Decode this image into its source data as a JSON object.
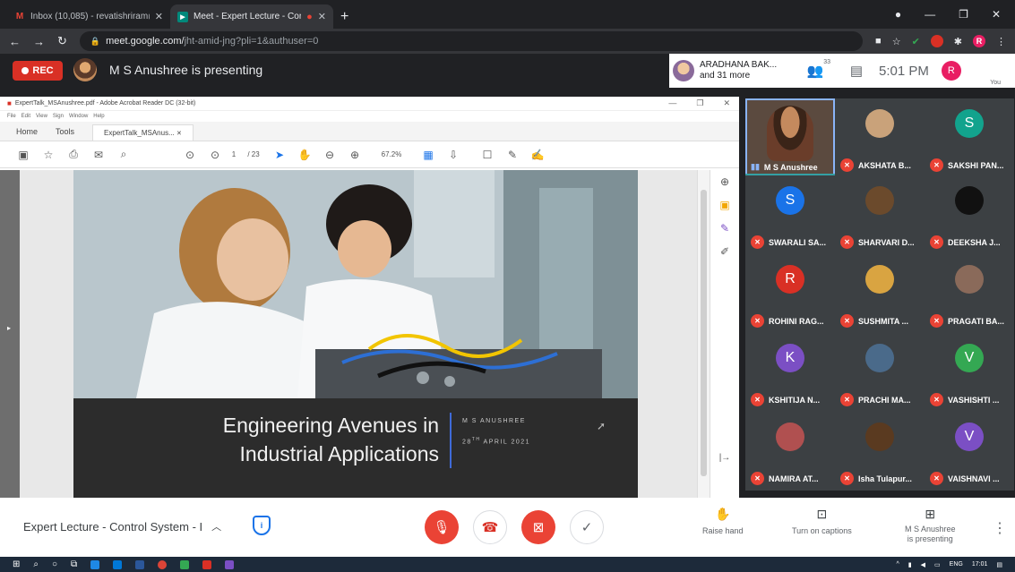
{
  "browser": {
    "tabs": [
      {
        "title": "Inbox (10,085) - revatishriram@...",
        "icon": "gmail-icon",
        "active": false
      },
      {
        "title": "Meet - Expert Lecture - Cont...",
        "icon": "meet-icon",
        "active": true
      }
    ],
    "url_host": "meet.google.com/",
    "url_path": "jht-amid-jng?pli=1&authuser=0",
    "profile_initial": "R"
  },
  "meet_header": {
    "rec_label": "REC",
    "presenting_text": "M S Anushree is presenting",
    "participant_name": "ARADHANA BAK...",
    "participant_more": "and 31 more",
    "participant_count": "33",
    "time": "5:01 PM",
    "you_initial": "R",
    "you_label": "You"
  },
  "acrobat": {
    "window_title": "ExpertTalk_MSAnushree.pdf - Adobe Acrobat Reader DC (32-bit)",
    "menu": [
      "File",
      "Edit",
      "View",
      "Sign",
      "Window",
      "Help"
    ],
    "tabs": [
      "Home",
      "Tools"
    ],
    "doc_tab": "ExpertTalk_MSAnus...",
    "page_current": "1",
    "page_total": "/ 23",
    "zoom": "67.2%"
  },
  "slide": {
    "title_line1": "Engineering Avenues in",
    "title_line2": "Industrial Applications",
    "author": "M S ANUSHREE",
    "date_day": "28",
    "date_suffix": "TH",
    "date_rest": "APRIL 2021"
  },
  "participants": [
    {
      "name": "M S Anushree",
      "type": "video",
      "speaking": true
    },
    {
      "name": "AKSHATA B...",
      "type": "photo",
      "color": "#c9a27a"
    },
    {
      "name": "SAKSHI PAN...",
      "type": "initial",
      "initial": "S",
      "color": "#12a38d"
    },
    {
      "name": "SWARALI SA...",
      "type": "initial",
      "initial": "S",
      "color": "#1a73e8"
    },
    {
      "name": "SHARVARI D...",
      "type": "photo",
      "color": "#6b4a2c"
    },
    {
      "name": "DEEKSHA J...",
      "type": "photo",
      "color": "#111111"
    },
    {
      "name": "ROHINI RAG...",
      "type": "initial",
      "initial": "R",
      "color": "#d93025"
    },
    {
      "name": "SUSHMITA ...",
      "type": "photo",
      "color": "#d9a441"
    },
    {
      "name": "PRAGATI BA...",
      "type": "photo",
      "color": "#8a6a5a"
    },
    {
      "name": "KSHITIJA N...",
      "type": "initial",
      "initial": "K",
      "color": "#7b4fc4"
    },
    {
      "name": "PRACHI MA...",
      "type": "photo",
      "color": "#4a6a8a"
    },
    {
      "name": "VASHISHTI ...",
      "type": "initial",
      "initial": "V",
      "color": "#34a853"
    },
    {
      "name": "NAMIRA AT...",
      "type": "photo",
      "color": "#b05050"
    },
    {
      "name": "Isha Tulapur...",
      "type": "photo",
      "color": "#5a3a20"
    },
    {
      "name": "VAISHNAVI ...",
      "type": "initial",
      "initial": "V",
      "color": "#7b4fc4"
    }
  ],
  "controls": {
    "meeting_title": "Expert Lecture - Control System - I",
    "raise_hand": "Raise hand",
    "captions": "Turn on captions",
    "present_line1": "M S Anushree",
    "present_line2": "is presenting"
  },
  "taskbar": {
    "lang": "ENG",
    "time": "17:01"
  }
}
